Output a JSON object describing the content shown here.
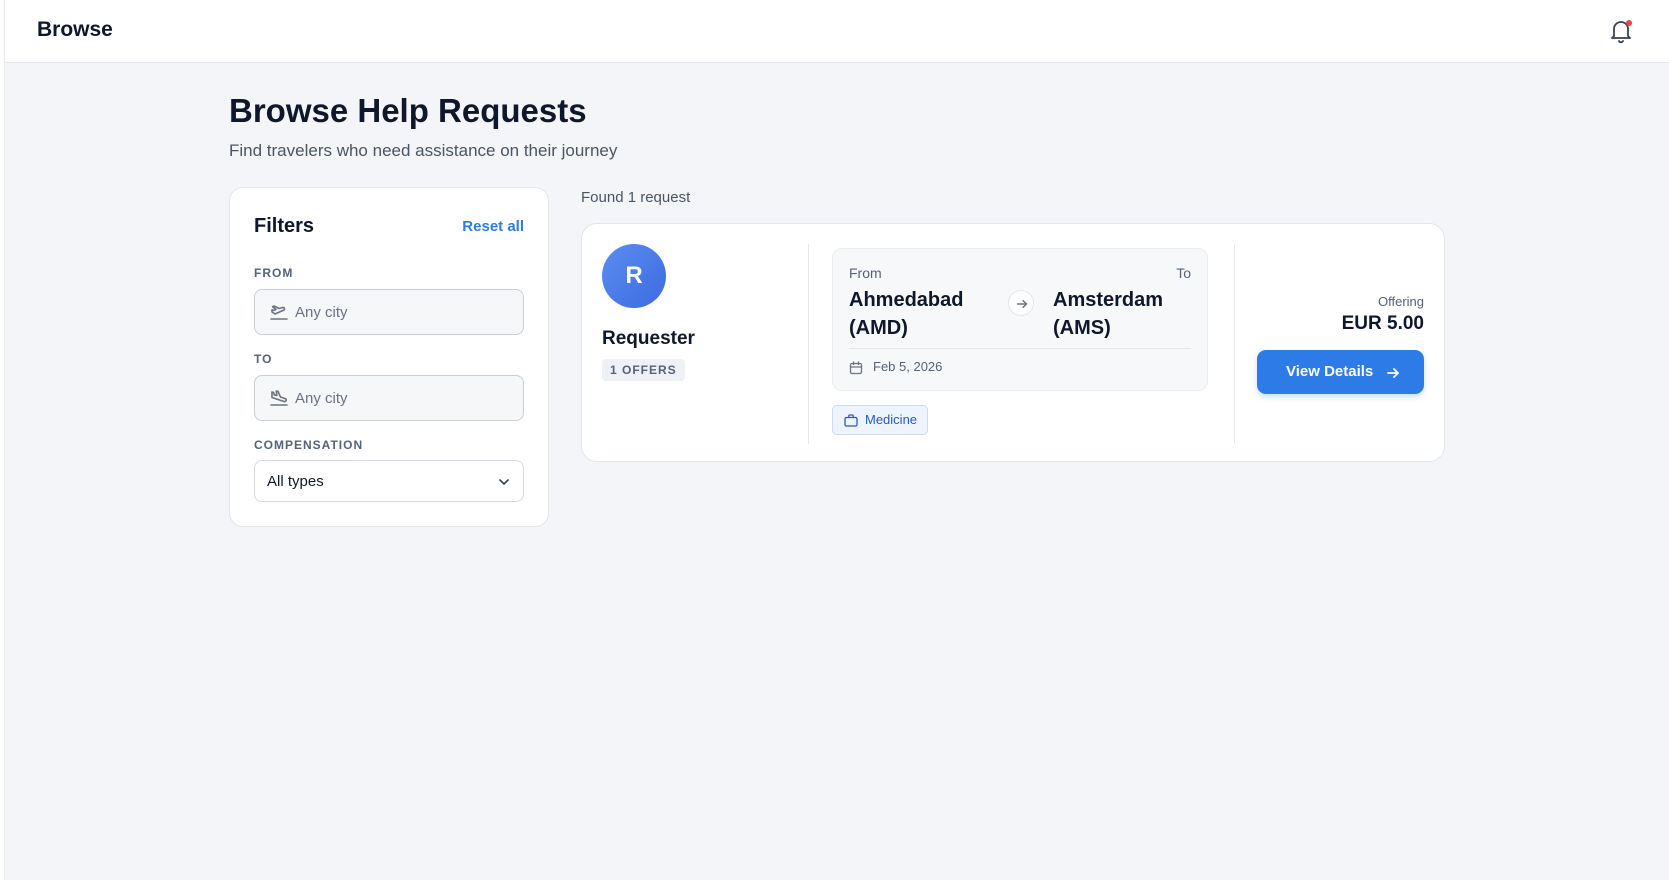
{
  "header": {
    "title": "Browse",
    "notification_icon": "bell-icon",
    "notification_dot_color": "#ef4444"
  },
  "page": {
    "title": "Browse Help Requests",
    "subtitle": "Find travelers who need assistance on their journey"
  },
  "filters": {
    "title": "Filters",
    "reset_label": "Reset all",
    "from": {
      "label": "FROM",
      "placeholder": "Any city",
      "icon": "plane-takeoff-icon"
    },
    "to": {
      "label": "TO",
      "placeholder": "Any city",
      "icon": "plane-landing-icon"
    },
    "compensation": {
      "label": "COMPENSATION",
      "value": "All types"
    }
  },
  "results": {
    "count_text": "Found 1 request",
    "items": [
      {
        "avatar_initial": "R",
        "requester_name": "Requester",
        "offers_badge": "1 OFFERS",
        "from_label": "From",
        "to_label": "To",
        "from_city": "Ahmedabad (AMD)",
        "to_city": "Amsterdam (AMS)",
        "date": "Feb 5, 2026",
        "category": "Medicine",
        "offering_label": "Offering",
        "offering_value": "EUR 5.00",
        "button_label": "View Details"
      }
    ]
  },
  "colors": {
    "accent": "#2d7be6",
    "background": "#f3f5f8"
  }
}
